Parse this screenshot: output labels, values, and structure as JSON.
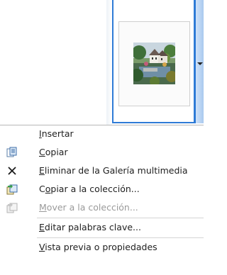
{
  "gallery": {
    "thumbnail_icon": "landscape-clipart-thumbnail",
    "dropdown_icon": "chevron-down-icon"
  },
  "menu": {
    "items": [
      {
        "label": "Insertar",
        "icon": "none",
        "enabled": true,
        "underline_char": "I"
      },
      {
        "label": "Copiar",
        "icon": "copy-icon",
        "enabled": true,
        "underline_char": "C"
      },
      {
        "label": "Eliminar de la Galería multimedia",
        "icon": "delete-x-icon",
        "enabled": true,
        "underline_char": "E"
      },
      {
        "label": "Copiar a la colección...",
        "icon": "copy-to-collection-icon",
        "enabled": true,
        "underline_char": "o"
      },
      {
        "label": "Mover a la colección...",
        "icon": "move-to-collection-icon",
        "enabled": false,
        "underline_char": "M"
      },
      {
        "label": "Editar palabras clave...",
        "icon": "none",
        "enabled": true,
        "underline_char": "E"
      },
      {
        "label": "Vista previa o propiedades",
        "icon": "none",
        "enabled": true,
        "underline_char": "V"
      }
    ]
  },
  "colors": {
    "selection_border": "#2f7bd6",
    "text": "#1f1f1f",
    "disabled_text": "#9a9a9a"
  }
}
